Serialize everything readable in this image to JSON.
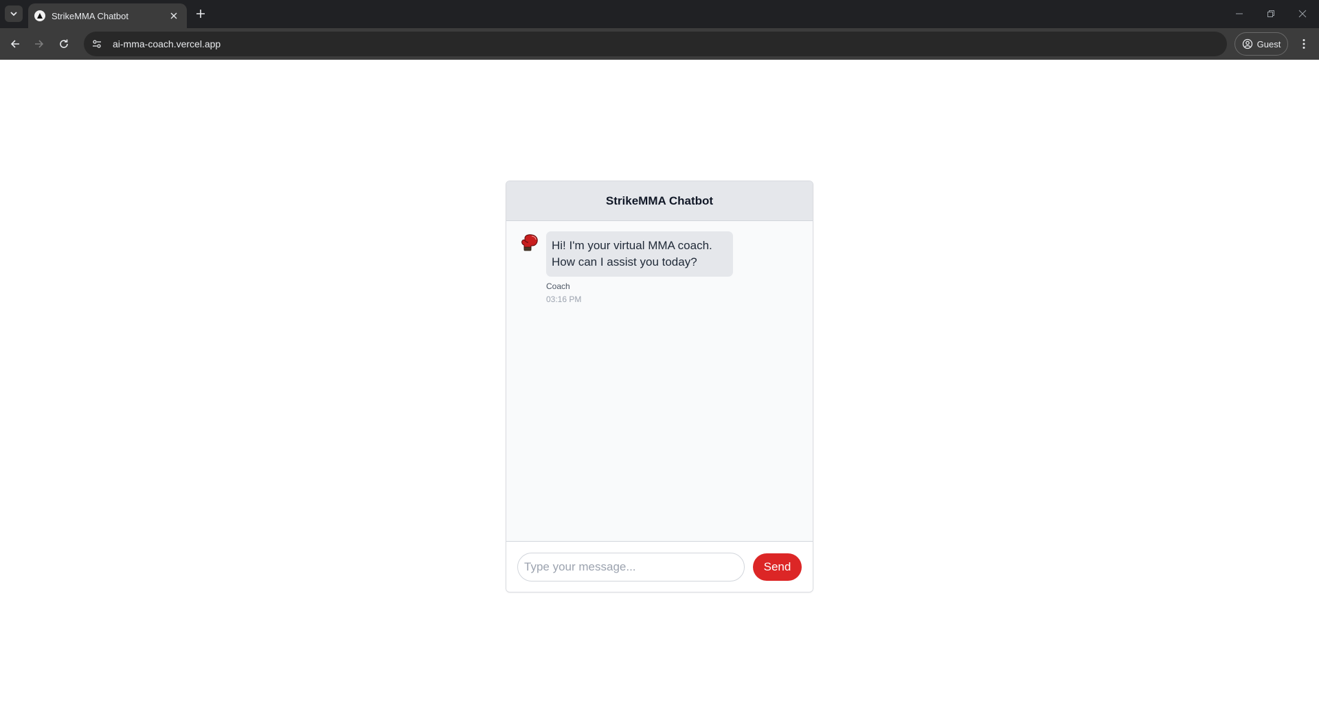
{
  "browser": {
    "tab_title": "StrikeMMA Chatbot",
    "url": "ai-mma-coach.vercel.app",
    "profile_label": "Guest"
  },
  "chat": {
    "title": "StrikeMMA Chatbot",
    "messages": [
      {
        "text": "Hi! I'm your virtual MMA coach. How can I assist you today?",
        "sender": "Coach",
        "time": "03:16 PM",
        "avatar_icon": "boxing-glove-icon"
      }
    ],
    "input_placeholder": "Type your message...",
    "input_value": "",
    "send_label": "Send"
  },
  "colors": {
    "accent": "#dc2626",
    "bubble": "#e5e7eb",
    "header": "#e5e7eb"
  }
}
